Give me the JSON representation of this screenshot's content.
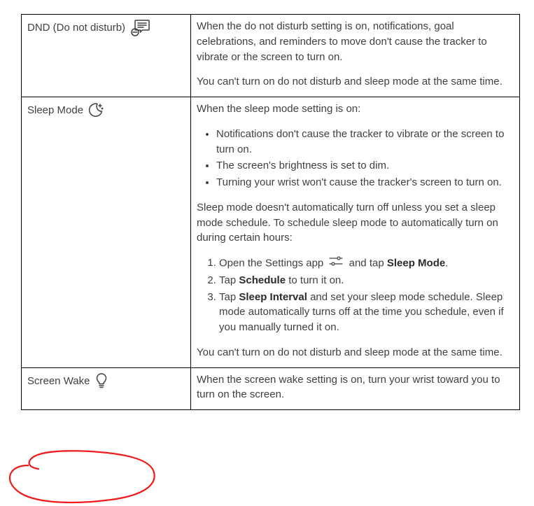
{
  "rows": {
    "dnd": {
      "label": "DND (Do not disturb)",
      "p1": "When the do not disturb setting is on, notifications, goal celebrations, and reminders to move don't cause the tracker to vibrate or the screen to turn on.",
      "p2": "You can't turn on do not disturb and sleep mode at the same time."
    },
    "sleep": {
      "label": "Sleep Mode",
      "intro": "When the sleep mode setting is on:",
      "bullet1": "Notifications don't cause the tracker to vibrate or the screen to turn on.",
      "bullet2": "The screen's brightness is set to dim.",
      "bullet3": "Turning your wrist won't cause the tracker's screen to turn on.",
      "mid": "Sleep mode doesn't automatically turn off unless you set a sleep mode schedule. To schedule sleep mode to automatically turn on during certain hours:",
      "step1_pre": "Open the Settings app",
      "step1_post": "and tap",
      "step1_bold": "Sleep Mode",
      "step2_pre": "Tap",
      "step2_bold": "Schedule",
      "step2_post": "to turn it on.",
      "step3_pre": "Tap",
      "step3_bold": "Sleep Interval",
      "step3_post": "and set your sleep mode schedule. Sleep mode automatically turns off at the time you schedule, even if you manually turned it on.",
      "outro": "You can't turn on do not disturb and sleep mode at the same time."
    },
    "wake": {
      "label": "Screen Wake",
      "p1": "When the screen wake setting is on, turn your wrist toward you to turn on the screen."
    }
  }
}
